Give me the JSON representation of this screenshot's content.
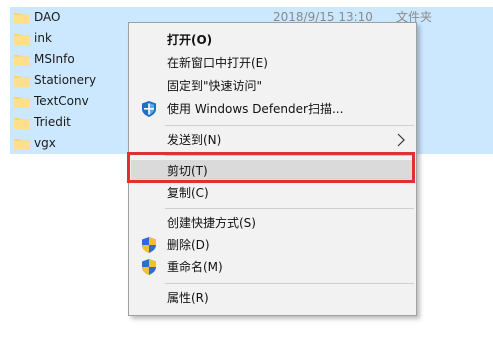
{
  "files": [
    {
      "name": "DAO",
      "date": "2018/9/15 13:10",
      "type": "文件夹"
    },
    {
      "name": "ink",
      "date": "",
      "type": "夹"
    },
    {
      "name": "MSInfo",
      "date": "",
      "type": "夹"
    },
    {
      "name": "Stationery",
      "date": "",
      "type": "夹"
    },
    {
      "name": "TextConv",
      "date": "",
      "type": "夹"
    },
    {
      "name": "Triedit",
      "date": "",
      "type": "夹"
    },
    {
      "name": "vgx",
      "date": "",
      "type": "夹"
    }
  ],
  "menu": {
    "open": "打开(O)",
    "open_new_window": "在新窗口中打开(E)",
    "pin_quick_access": "固定到\"快速访问\"",
    "defender_scan": "使用 Windows Defender扫描...",
    "send_to": "发送到(N)",
    "cut": "剪切(T)",
    "copy": "复制(C)",
    "create_shortcut": "创建快捷方式(S)",
    "delete": "删除(D)",
    "rename": "重命名(M)",
    "properties": "属性(R)"
  },
  "colors": {
    "selection": "#cce8ff",
    "menu_bg": "#f2f2f2",
    "highlight": "#dadada",
    "callout": "#e03030",
    "folder": "#f8d775"
  },
  "icons": {
    "folder": "folder-icon",
    "defender": "defender-shield-icon",
    "uac": "uac-shield-icon",
    "submenu": "chevron-right-icon"
  }
}
